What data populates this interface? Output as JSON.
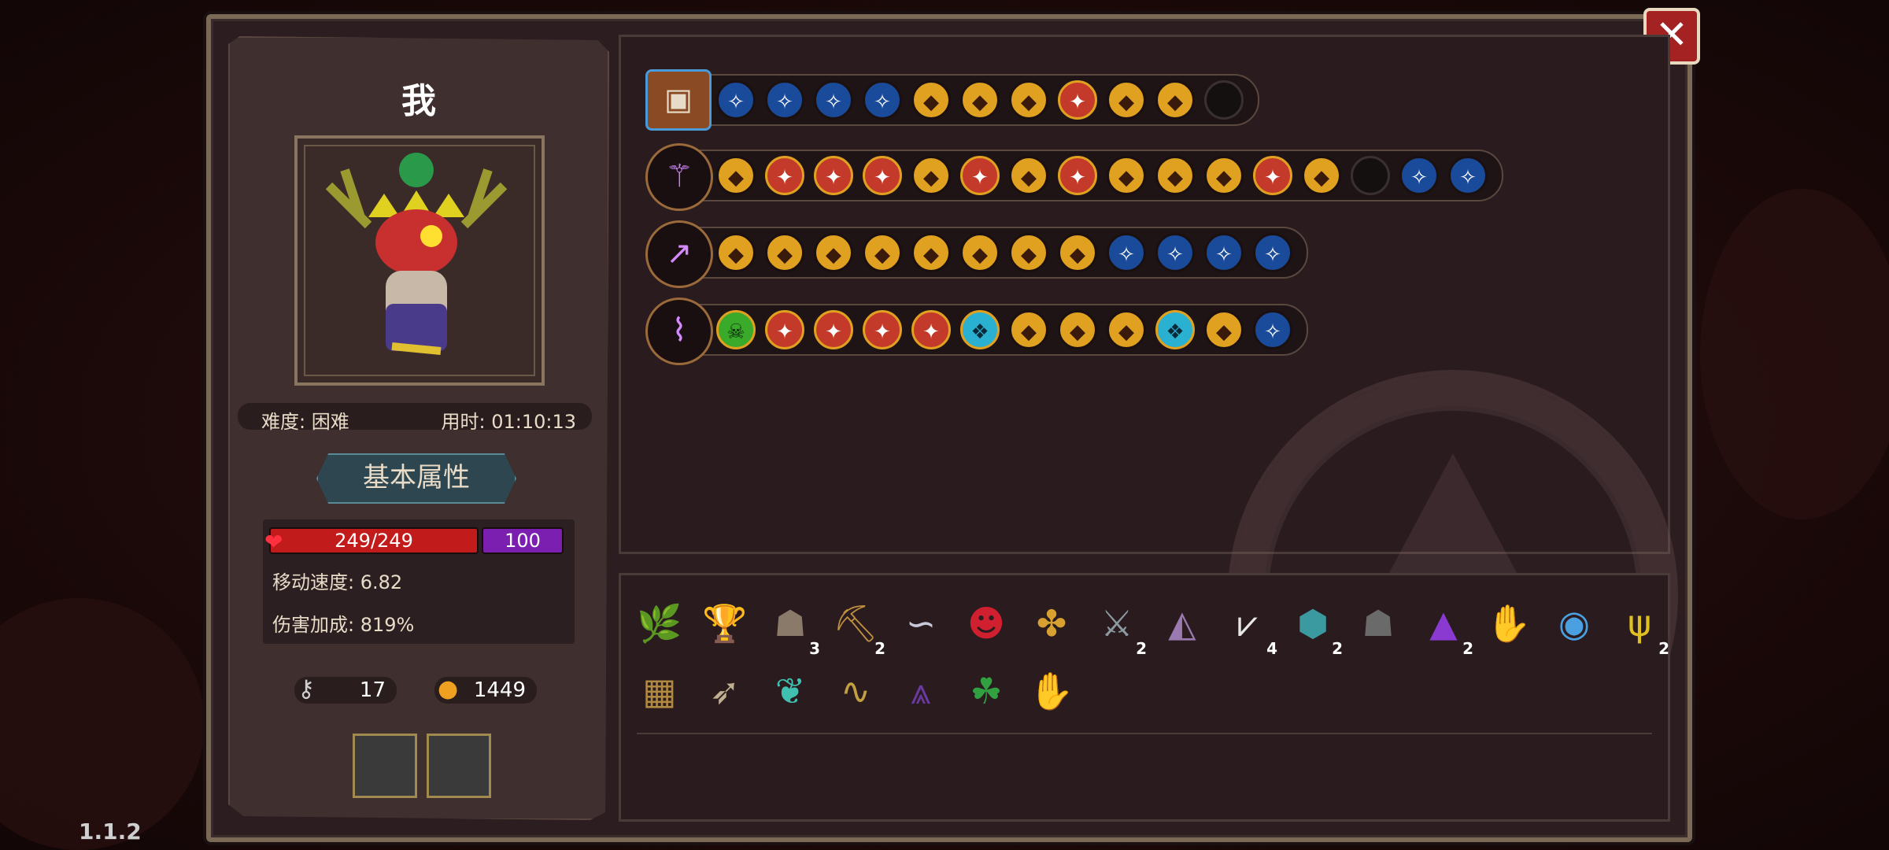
{
  "player": {
    "name": "我",
    "difficulty": "难度: 困难",
    "time": "用时: 01:10:13"
  },
  "section_title": "基本属性",
  "stats": {
    "hp": "249/249",
    "mp": "100",
    "move_speed": "移动速度: 6.82",
    "damage_bonus": "伤害加成: 819%"
  },
  "resources": {
    "keys": "17",
    "coins": "1449"
  },
  "version": "1.1.2",
  "close_label": "✕",
  "weapon_rows": [
    {
      "weapon_icon": "chest-icon",
      "slots": [
        "blue",
        "blue",
        "blue",
        "blue",
        "gold",
        "gold",
        "gold",
        "red",
        "gold",
        "gold",
        "empty"
      ]
    },
    {
      "weapon_icon": "staff-icon",
      "slots": [
        "gold",
        "red",
        "red",
        "red",
        "gold",
        "red",
        "gold",
        "red",
        "gold",
        "gold",
        "gold",
        "red",
        "gold",
        "empty",
        "blue",
        "blue"
      ]
    },
    {
      "weapon_icon": "spear-icon",
      "slots": [
        "gold",
        "gold",
        "gold",
        "gold",
        "gold",
        "gold",
        "gold",
        "gold",
        "blue",
        "blue",
        "blue",
        "blue"
      ]
    },
    {
      "weapon_icon": "broom-icon",
      "slots": [
        "green",
        "red",
        "red",
        "red",
        "red",
        "cyan",
        "gold",
        "gold",
        "gold",
        "cyan",
        "gold",
        "blue"
      ]
    }
  ],
  "items": [
    {
      "name": "antler-branch-icon",
      "count": ""
    },
    {
      "name": "golden-goblet-icon",
      "count": ""
    },
    {
      "name": "hooded-cloak-icon",
      "count": "3"
    },
    {
      "name": "pickaxe-icon",
      "count": "2"
    },
    {
      "name": "silver-hook-icon",
      "count": ""
    },
    {
      "name": "demon-mask-icon",
      "count": ""
    },
    {
      "name": "golden-feather-icon",
      "count": ""
    },
    {
      "name": "stone-sword-icon",
      "count": "2"
    },
    {
      "name": "dark-hood-icon",
      "count": ""
    },
    {
      "name": "fang-jaw-icon",
      "count": "4"
    },
    {
      "name": "jewel-box-icon",
      "count": "2"
    },
    {
      "name": "stone-idol-icon",
      "count": ""
    },
    {
      "name": "wizard-hat-icon",
      "count": "2"
    },
    {
      "name": "crystal-glove-icon",
      "count": ""
    },
    {
      "name": "blue-orb-icon",
      "count": ""
    },
    {
      "name": "golden-antler-icon",
      "count": "2"
    },
    {
      "name": "rune-tablet-icon",
      "count": ""
    },
    {
      "name": "bone-arrow-icon",
      "count": ""
    },
    {
      "name": "teal-shell-icon",
      "count": ""
    },
    {
      "name": "serpent-whip-icon",
      "count": ""
    },
    {
      "name": "purple-cape-icon",
      "count": ""
    },
    {
      "name": "four-leaf-clover-icon",
      "count": ""
    },
    {
      "name": "green-hand-icon",
      "count": ""
    }
  ]
}
